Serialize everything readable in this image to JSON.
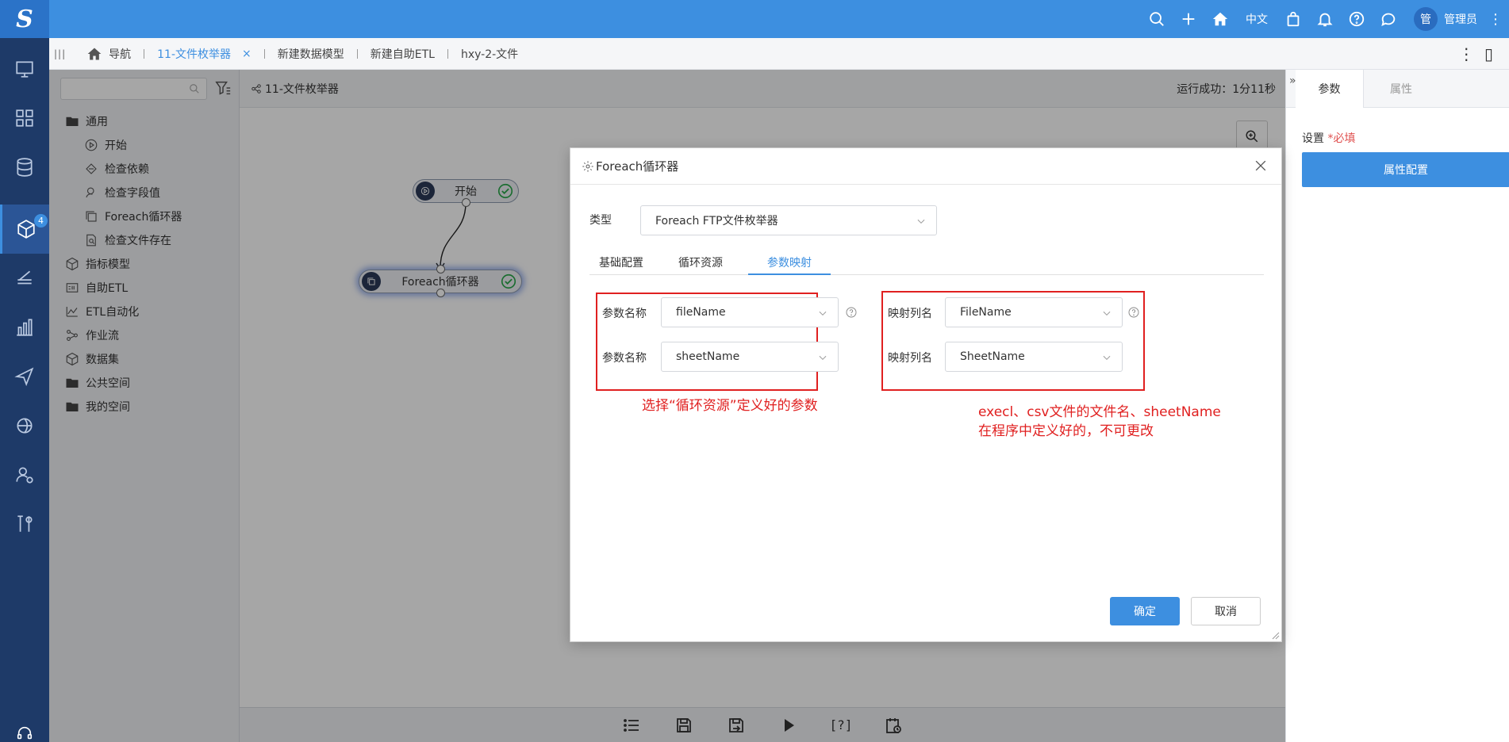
{
  "topbar": {
    "language": "中文",
    "avatar_text": "管",
    "user_name": "管理员"
  },
  "leftnav": {
    "badge": "4",
    "help_label": "答疑"
  },
  "tabs": {
    "home_label": "导航",
    "items": [
      {
        "label": "11-文件枚举器",
        "close": "×"
      },
      {
        "label": "新建数据模型"
      },
      {
        "label": "新建自助ETL"
      },
      {
        "label": "hxy-2-文件"
      }
    ]
  },
  "tree": {
    "general": "通用",
    "children": [
      "开始",
      "检查依赖",
      "检查字段值",
      "Foreach循环器",
      "检查文件存在"
    ],
    "others": [
      "指标模型",
      "自助ETL",
      "ETL自动化",
      "作业流",
      "数据集",
      "公共空间",
      "我的空间"
    ]
  },
  "canvas": {
    "title": "11-文件枚举器",
    "status": "运行成功：1分11秒",
    "nodes": {
      "start": "开始",
      "foreach": "Foreach循环器"
    }
  },
  "right_panel": {
    "tab_params": "参数",
    "tab_props": "属性",
    "setting_label": "设置",
    "required_label": "*必填",
    "config_button": "属性配置"
  },
  "dialog": {
    "title": "Foreach循环器",
    "type_label": "类型",
    "type_value": "Foreach FTP文件枚举器",
    "tabs": [
      "基础配置",
      "循环资源",
      "参数映射"
    ],
    "param_label": "参数名称",
    "map_label": "映射列名",
    "params": [
      {
        "name": "fileName",
        "column": "FileName"
      },
      {
        "name": "sheetName",
        "column": "SheetName"
      }
    ],
    "note_left": "选择“循环资源”定义好的参数",
    "note_right_1": "execl、csv文件的文件名、sheetName",
    "note_right_2": "在程序中定义好的，不可更改",
    "ok": "确定",
    "cancel": "取消"
  },
  "colors": {
    "accent": "#3d8fe0",
    "nav_bg": "#1e3a68",
    "annotation_red": "#e02020"
  }
}
